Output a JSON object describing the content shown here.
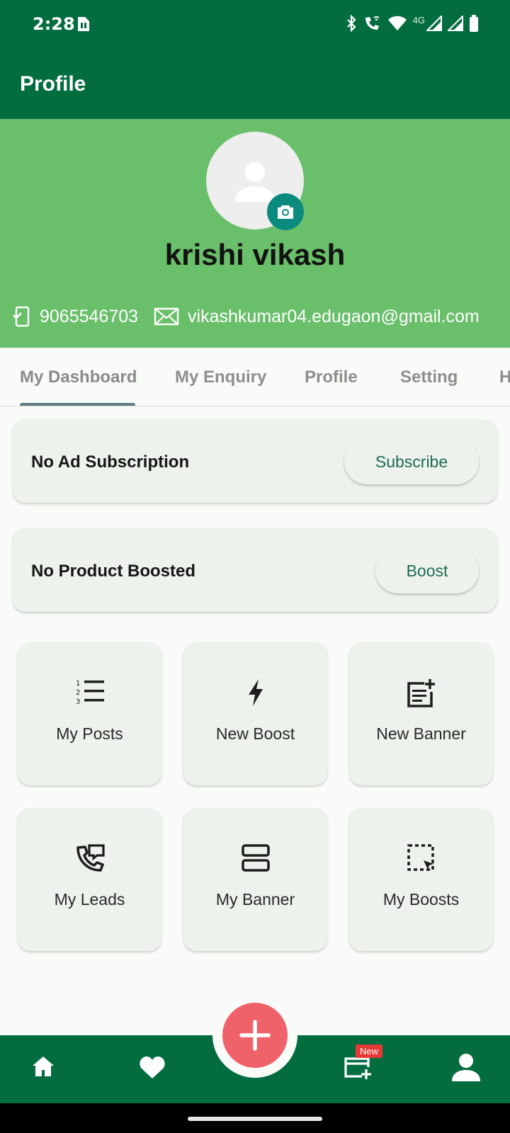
{
  "status_bar": {
    "time": "2:28",
    "network_label": "4G",
    "icons": [
      "sim-card-icon",
      "bluetooth-icon",
      "wifi-calling-icon",
      "wifi-icon",
      "signal-icon",
      "signal-icon",
      "battery-icon"
    ]
  },
  "appbar": {
    "title": "Profile"
  },
  "profile": {
    "name": "krishi vikash",
    "phone": "9065546703",
    "email": "vikashkumar04.edugaon@gmail.com"
  },
  "tabs": [
    {
      "label": "My Dashboard",
      "selected": true
    },
    {
      "label": "My Enquiry",
      "selected": false
    },
    {
      "label": "Profile",
      "selected": false
    },
    {
      "label": "Setting",
      "selected": false
    },
    {
      "label": "H",
      "selected": false
    }
  ],
  "subscription_card": {
    "text": "No Ad Subscription",
    "button": "Subscribe"
  },
  "boost_card": {
    "text": "No Product Boosted",
    "button": "Boost"
  },
  "tiles": [
    {
      "label": "My Posts",
      "icon": "numbered-list-icon"
    },
    {
      "label": "New Boost",
      "icon": "lightning-icon"
    },
    {
      "label": "New Banner",
      "icon": "post-add-icon"
    },
    {
      "label": "My Leads",
      "icon": "phone-message-icon"
    },
    {
      "label": "My Banner",
      "icon": "stacked-panels-icon"
    },
    {
      "label": "My Boosts",
      "icon": "selection-pointer-icon"
    }
  ],
  "bottom_nav": {
    "items": [
      "home-icon",
      "favorite-icon",
      "add-icon",
      "add-calendar-icon",
      "account-icon"
    ],
    "badge": "New"
  },
  "colors": {
    "primary_dark": "#046d40",
    "header_green": "#6abf6b",
    "fab_red": "#f0626a",
    "camera_teal": "#0b8a7e",
    "card_bg": "#edf2ed"
  }
}
